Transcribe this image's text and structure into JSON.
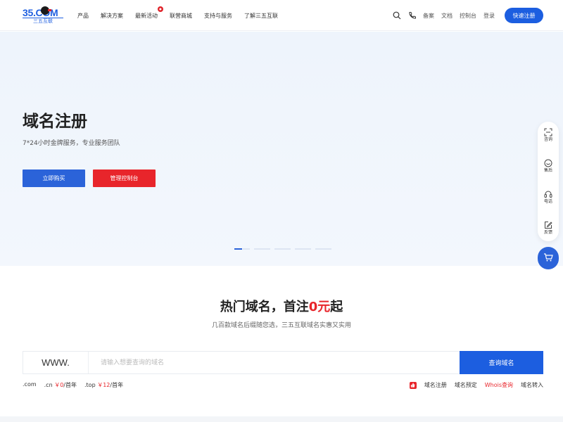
{
  "header": {
    "logo_text": "35.COM",
    "logo_sub": "三五互联",
    "nav": [
      {
        "label": "产品"
      },
      {
        "label": "解决方案"
      },
      {
        "label": "最新活动",
        "badge": "hot"
      },
      {
        "label": "联营商城"
      },
      {
        "label": "支持与服务"
      },
      {
        "label": "了解三五互联"
      }
    ],
    "links": [
      "备案",
      "文档",
      "控制台",
      "登录"
    ],
    "register_label": "快速注册"
  },
  "hero": {
    "title": "域名注册",
    "subtitle": "7*24小时金牌服务，专业服务团队",
    "buy_label": "立即购买",
    "console_label": "管理控制台"
  },
  "sidebar": {
    "items": [
      {
        "label": "咨询",
        "icon": "scan-icon"
      },
      {
        "label": "售后",
        "icon": "chat-icon"
      },
      {
        "label": "电话",
        "icon": "headset-icon"
      },
      {
        "label": "反馈",
        "icon": "edit-icon"
      }
    ],
    "cart_icon": "cart-icon"
  },
  "domain_section": {
    "title_prefix": "热门域名，首注",
    "title_highlight": "0元",
    "title_suffix": "起",
    "subtitle": "几百款域名后缀随您选，三五互联域名实惠又实用",
    "prefix": "WWW.",
    "placeholder": "请输入想要查询的域名",
    "search_label": "查询域名",
    "prices": [
      {
        "ext": ".com",
        "price": ""
      },
      {
        "ext": ".cn",
        "price": "￥0",
        "unit": "/首年"
      },
      {
        "ext": ".top",
        "price": "￥12",
        "unit": "/首年"
      }
    ],
    "quick_links": [
      "域名注册",
      "域名预定",
      "Whois查询",
      "域名转入"
    ]
  },
  "colors": {
    "primary": "#1c5ee0",
    "accent": "#e8252b"
  }
}
